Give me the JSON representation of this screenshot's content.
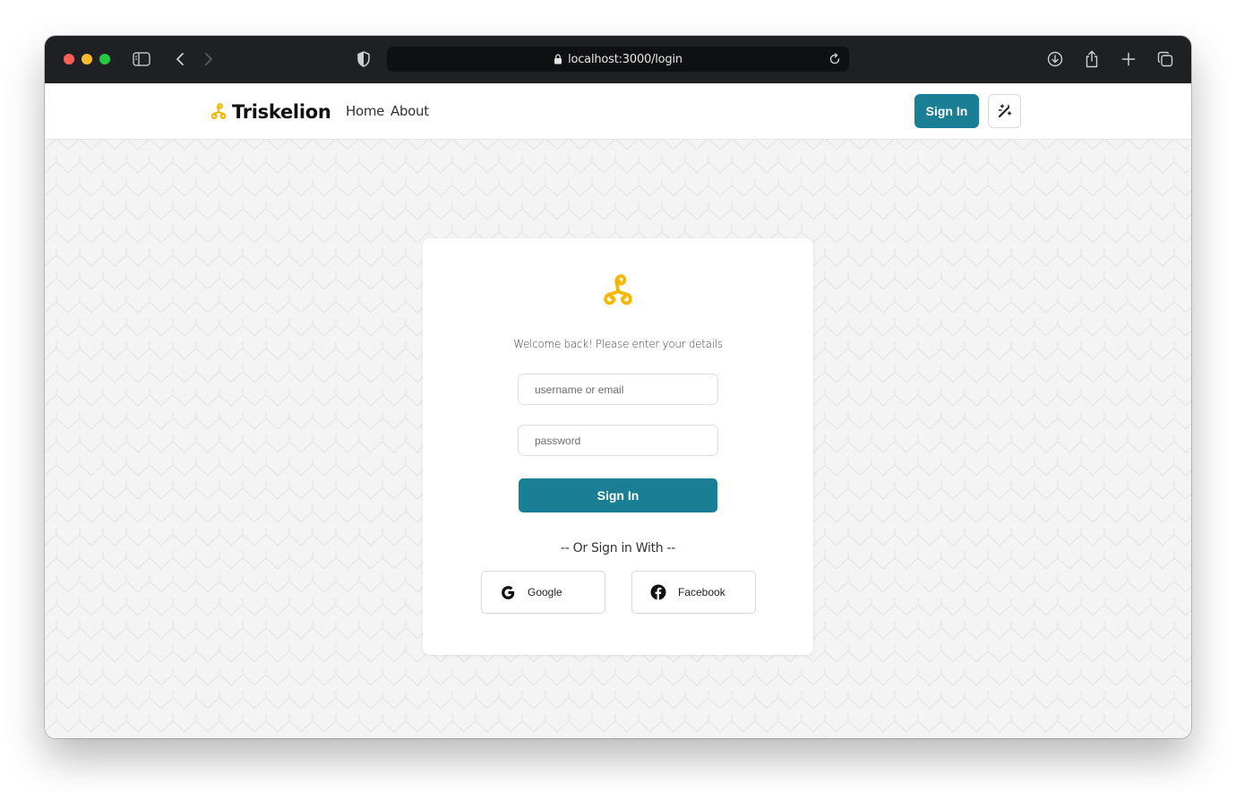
{
  "browser": {
    "url": "localhost:3000/login",
    "icons": [
      "sidebar-icon",
      "back-icon",
      "forward-icon",
      "shield-icon",
      "lock-icon",
      "reload-icon",
      "download-icon",
      "share-icon",
      "new-tab-icon",
      "tabs-icon"
    ]
  },
  "navbar": {
    "brand": "Triskelion",
    "links": [
      "Home",
      "About"
    ],
    "signin_label": "Sign In",
    "theme_icon": "magic-wand-icon"
  },
  "login": {
    "welcome": "Welcome back! Please enter your details",
    "username_placeholder": "username or email",
    "password_placeholder": "password",
    "submit_label": "Sign In",
    "divider": "-- Or Sign in With --",
    "social": [
      {
        "label": "Google",
        "icon": "google-icon"
      },
      {
        "label": "Facebook",
        "icon": "facebook-icon"
      }
    ]
  },
  "colors": {
    "accent": "#1a7f95",
    "logo": "#f5b800",
    "chrome": "#1f2023"
  }
}
